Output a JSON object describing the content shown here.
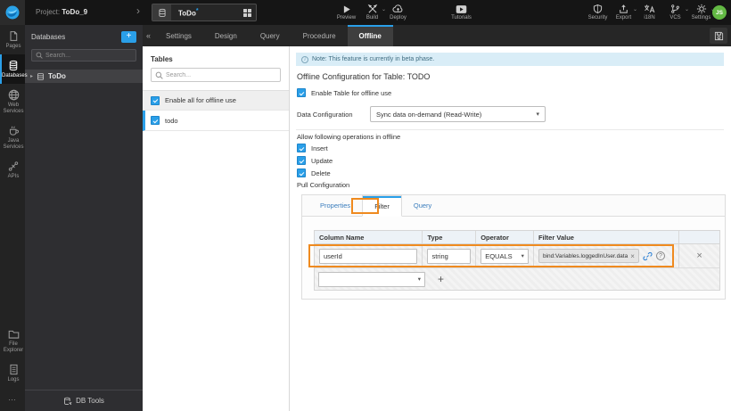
{
  "icons": {
    "plus": "+",
    "collapse": "«",
    "chevron": "›",
    "tree_expand": "▸",
    "caret": "▾",
    "caret_small": "⌄",
    "close": "×",
    "more": "…",
    "info": "i",
    "question": "?",
    "modified": "*",
    "add": "+"
  },
  "topbar": {
    "project_label": "Project:",
    "project_name": "ToDo_9",
    "entity_tab_label": "ToDo",
    "preview": "Preview",
    "build": "Build",
    "deploy": "Deploy",
    "tutorials": "Tutorials",
    "security": "Security",
    "export": "Export",
    "i18n": "i18N",
    "vcs": "VCS",
    "settings": "Settings",
    "avatar_initials": "JS"
  },
  "sidebar": {
    "pages": "Pages",
    "databases": "Databases",
    "web_services": "Web Services",
    "java_services": "Java Services",
    "apis": "APIs",
    "file_explorer": "File Explorer",
    "logs": "Logs"
  },
  "db_panel": {
    "title": "Databases",
    "search_placeholder": "Search...",
    "tree_item": "ToDo",
    "footer": "DB Tools"
  },
  "tables_panel": {
    "title": "Tables",
    "search_placeholder": "Search...",
    "enable_all": "Enable all for offline use",
    "table_name": "todo"
  },
  "entity_tabs": {
    "items": [
      "Settings",
      "Design",
      "Query",
      "Procedure",
      "Offline"
    ],
    "active": "Offline"
  },
  "offline": {
    "note": "Note: This feature is currently in beta phase.",
    "title": "Offline Configuration for Table: TODO",
    "enable_table": "Enable Table for offline use",
    "data_config_label": "Data Configuration",
    "data_config_value": "Sync data on-demand (Read-Write)",
    "operations_title": "Allow following operations in offline",
    "operations": [
      "Insert",
      "Update",
      "Delete"
    ],
    "pull_title": "Pull Configuration",
    "pull_tabs": [
      "Properties",
      "Filter",
      "Query"
    ],
    "pull_active_tab": "Filter",
    "filter_table": {
      "headers": [
        "Column Name",
        "Type",
        "Operator",
        "Filter Value"
      ],
      "row": {
        "column_name": "userId",
        "type": "string",
        "operator": "EQUALS",
        "filter_value": "bind:Variables.loggedInUser.data"
      }
    }
  },
  "colors": {
    "accent_blue": "#2a9fe8",
    "annotation_orange": "#ef8a1f",
    "note_bg": "#d9edf7",
    "avatar_green": "#63b944"
  }
}
